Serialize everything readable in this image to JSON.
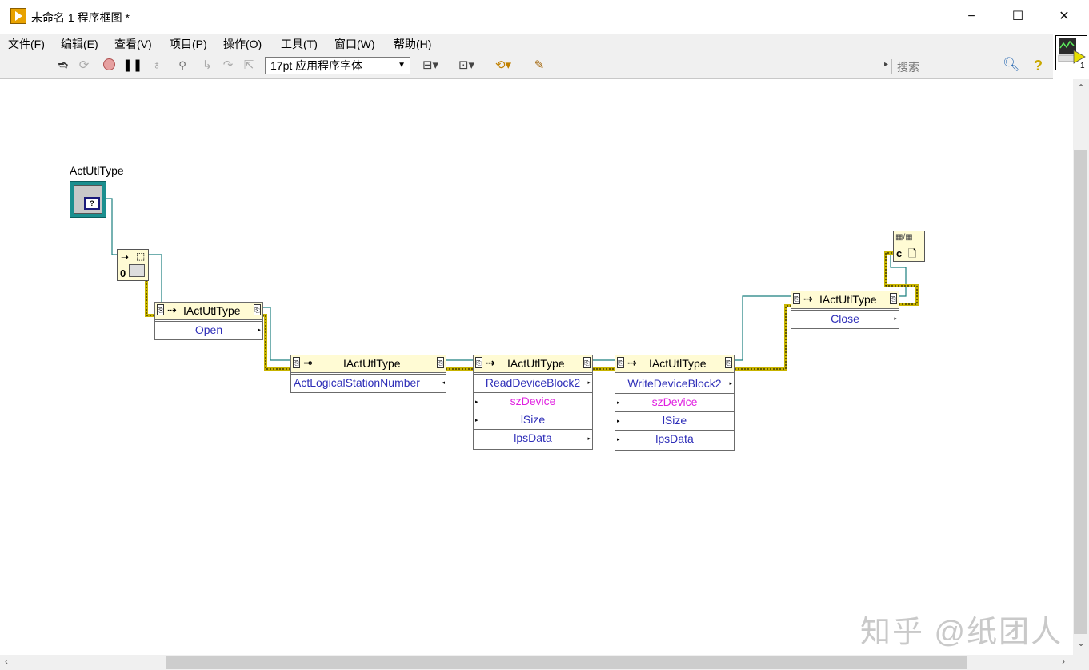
{
  "window": {
    "title": "未命名 1 程序框图 *",
    "minimize": "−",
    "maximize": "☐",
    "close": "✕"
  },
  "menu": [
    "文件(F)",
    "编辑(E)",
    "查看(V)",
    "项目(P)",
    "操作(O)",
    "工具(T)",
    "窗口(W)",
    "帮助(H)"
  ],
  "toolbar": {
    "font_select": "17pt 应用程序字体",
    "search_placeholder": "搜索",
    "search_expander": "▸",
    "help": "?",
    "icons": [
      "run-arrow-icon",
      "run-continuous-icon",
      "abort-icon",
      "pause-icon",
      "highlight-bulb-icon",
      "retain-wire-icon",
      "step-into-icon",
      "step-over-icon",
      "step-out-icon",
      "align-icon",
      "distribute-icon",
      "reorder-icon",
      "cleanup-icon"
    ]
  },
  "diagram": {
    "constant_label": "ActUtlType",
    "nodes": {
      "open": {
        "title": "IActUtlType",
        "rows": [
          "Open"
        ]
      },
      "station": {
        "title": "IActUtlType",
        "rows": [
          "ActLogicalStationNumber"
        ]
      },
      "read": {
        "title": "IActUtlType",
        "rows": [
          "ReadDeviceBlock2",
          "szDevice",
          "lSize",
          "lpsData"
        ]
      },
      "write": {
        "title": "IActUtlType",
        "rows": [
          "WriteDeviceBlock2",
          "szDevice",
          "lSize",
          "lpsData"
        ]
      },
      "close": {
        "title": "IActUtlType",
        "rows": [
          "Close"
        ]
      }
    }
  },
  "watermark": "知乎 @纸团人",
  "colors": {
    "refnum_wire": "#1b7f7f",
    "error_wire": "#c8b400",
    "header_bg": "#fffbd4",
    "property_text": "#2e2eb8",
    "string_text": "#e020e0"
  }
}
